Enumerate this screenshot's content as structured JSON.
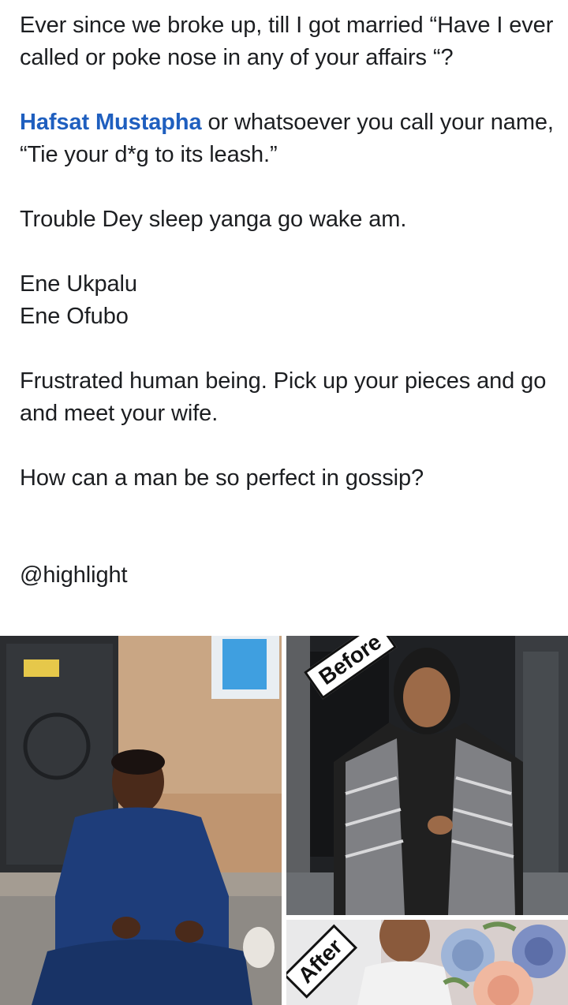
{
  "post": {
    "paragraph1": "Ever since we broke up, till I got married “Have I ever called or poke nose in any of your affairs “?",
    "mention": "Hafsat Mustapha",
    "paragraph2_rest": " or whatsoever you call your name, “Tie your d*g to its leash.”",
    "paragraph3": "Trouble Dey sleep yanga go wake am.",
    "line_ene1": "Ene Ukpalu",
    "line_ene2": "Ene Ofubo",
    "paragraph5": "Frustrated human being. Pick up your pieces and go and meet your wife.",
    "paragraph6": "How can a man be so perfect in gossip?",
    "hashtag": "@highlight"
  },
  "photos": {
    "before_label": "Before",
    "after_label": "After"
  }
}
